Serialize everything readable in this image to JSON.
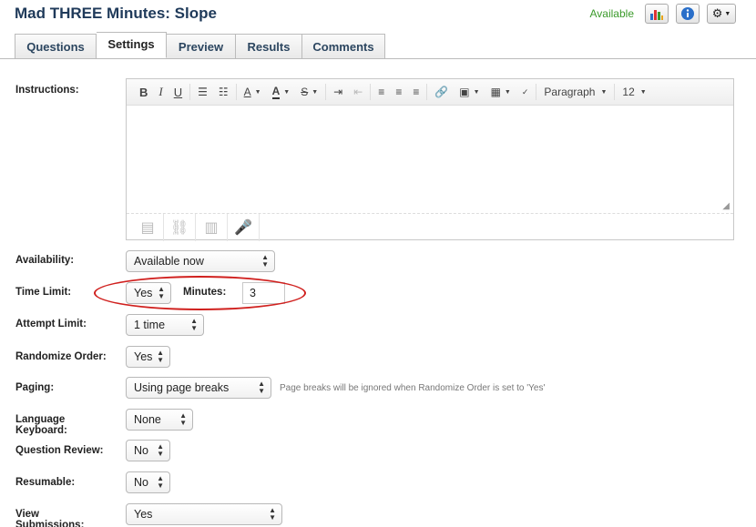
{
  "header": {
    "title": "Mad THREE Minutes: Slope",
    "status": "Available"
  },
  "tabs": [
    {
      "label": "Questions"
    },
    {
      "label": "Settings"
    },
    {
      "label": "Preview"
    },
    {
      "label": "Results"
    },
    {
      "label": "Comments"
    }
  ],
  "editor_toolbar": {
    "bold": "B",
    "italic": "I",
    "underline": "U",
    "paragraph": "Paragraph",
    "font_size": "12"
  },
  "form": {
    "instructions_label": "Instructions:",
    "availability": {
      "label": "Availability:",
      "value": "Available now"
    },
    "time_limit": {
      "label": "Time Limit:",
      "value": "Yes",
      "minutes_label": "Minutes:",
      "minutes_value": "3"
    },
    "attempt_limit": {
      "label": "Attempt Limit:",
      "value": "1 time"
    },
    "randomize": {
      "label": "Randomize Order:",
      "value": "Yes"
    },
    "paging": {
      "label": "Paging:",
      "value": "Using page breaks",
      "hint": "Page breaks will be ignored when Randomize Order is set to 'Yes'"
    },
    "language": {
      "label_line1": "Language",
      "label_line2": "Keyboard:",
      "value": "None"
    },
    "question_review": {
      "label": "Question Review:",
      "value": "No"
    },
    "resumable": {
      "label": "Resumable:",
      "value": "No"
    },
    "view_submissions": {
      "label_line1": "View",
      "label_line2": "Submissions:",
      "value": "Yes"
    }
  },
  "colors": {
    "title": "#1f3a5a",
    "available": "#3a9a2a",
    "highlight": "#d0201e"
  }
}
